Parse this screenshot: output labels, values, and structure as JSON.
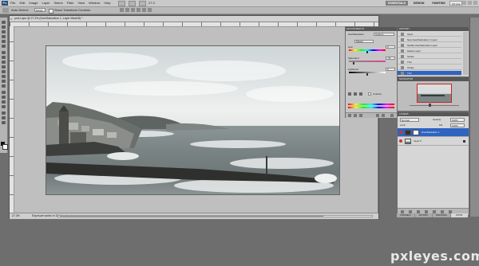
{
  "app": {
    "logo": "Ps",
    "zoom_menu": "27.3"
  },
  "menu": [
    "File",
    "Edit",
    "Image",
    "Layer",
    "Select",
    "Filter",
    "View",
    "Window",
    "Help"
  ],
  "workspaces": [
    {
      "label": "ESSENTIALS",
      "active": true
    },
    {
      "label": "DESIGN",
      "active": false
    },
    {
      "label": "PAINTING",
      "active": false
    }
  ],
  "cs5_search": "CS Live",
  "options_bar": {
    "auto_select_label": "Auto-Select:",
    "auto_select_value": "Group",
    "show_transform_label": "Show Transform Controls"
  },
  "document": {
    "tab_title": "port-Lapa @ 27.3% (Hue/Saturation 1, Layer Mask/8) *",
    "zoom": "27.3%",
    "status_info": "Exposure works in 32-bit only"
  },
  "adjustments": {
    "tab": "ADJUSTMENTS",
    "preset_label": "Hue/Saturation",
    "preset_value": "Custom",
    "channel_value": "Master",
    "hue_label": "Hue:",
    "hue_value": "0",
    "hue_level": 0.5,
    "saturation_label": "Saturation:",
    "saturation_value": "-76",
    "saturation_level": 0.12,
    "lightness_label": "Lightness:",
    "lightness_value": "0",
    "lightness_level": 0.5,
    "colorize_label": "Colorize"
  },
  "history": {
    "tab": "HISTORY",
    "items": [
      {
        "label": "Open",
        "active": false
      },
      {
        "label": "New Hue/Saturation 1 Layer",
        "active": false
      },
      {
        "label": "Modify Hue/Saturation Layer",
        "active": false
      },
      {
        "label": "Delete Layer",
        "active": false
      },
      {
        "label": "Stroke",
        "active": false
      },
      {
        "label": "Trim",
        "active": false
      },
      {
        "label": "Stroke",
        "active": false
      },
      {
        "label": "Trim",
        "active": true
      }
    ]
  },
  "navigator": {
    "tab": "NAVIGATOR"
  },
  "layers": {
    "tab": "LAYERS",
    "blend_mode": "Normal",
    "opacity_label": "Opacity:",
    "opacity_value": "100%",
    "lock_label": "Lock:",
    "fill_label": "Fill:",
    "fill_value": "100%",
    "items": [
      {
        "name": "Hue/Saturation 1",
        "active": true,
        "type": "adjustment"
      },
      {
        "name": "Layer 0",
        "active": false,
        "type": "pixel"
      }
    ]
  },
  "bottom_tabs": [
    {
      "label": "CHANNELS",
      "active": false
    },
    {
      "label": "ACTIONS",
      "active": false
    },
    {
      "label": "SWATCHES",
      "active": false
    },
    {
      "label": "PATHS",
      "active": true
    }
  ],
  "watermark": "pxleyes.com",
  "colors": {
    "selection": "#2f63c0",
    "panel_header": "#575757",
    "foreground": "#111111",
    "background": "#ffffff"
  }
}
